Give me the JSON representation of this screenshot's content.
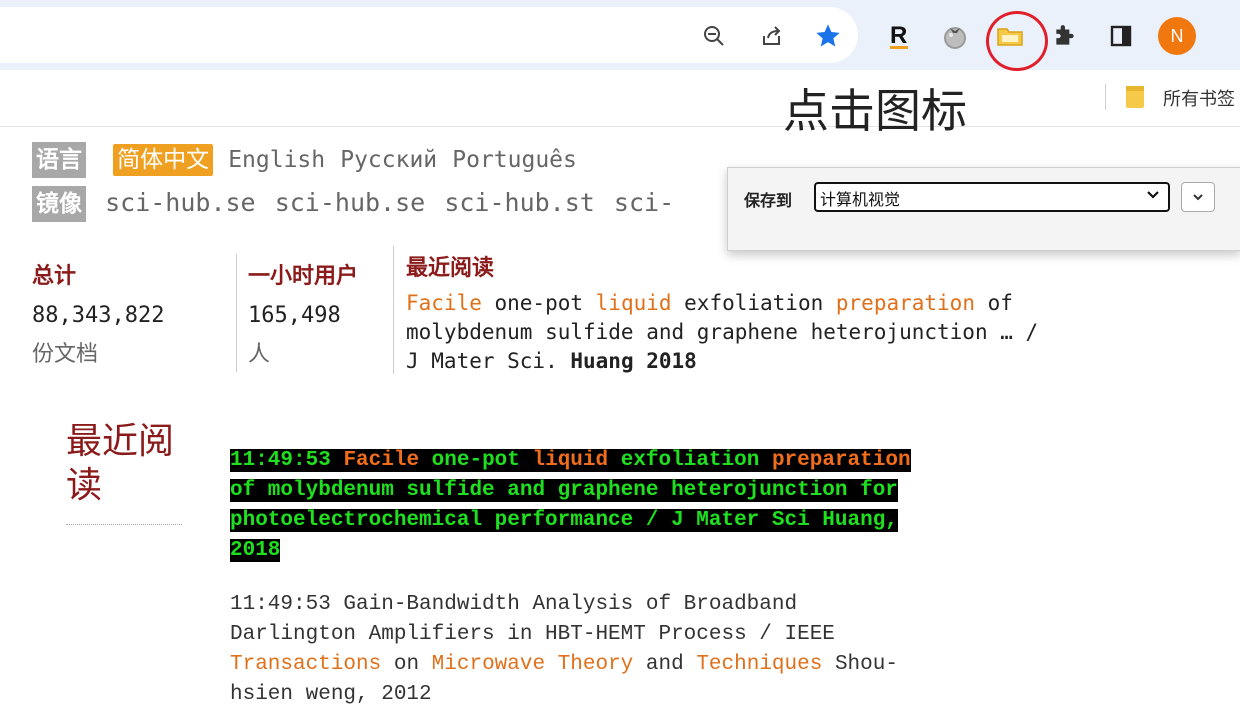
{
  "chrome": {
    "profile_initial": "N",
    "bookmarks_label": "所有书签",
    "icons": [
      "zoom-icon",
      "share-icon",
      "star-icon",
      "r-extension-icon",
      "tomato-extension-icon",
      "folder-extension-icon",
      "puzzle-extensions-icon",
      "side-panel-icon",
      "profile-avatar"
    ],
    "accent_star": "#1a73e8",
    "profile_color": "#f0780f"
  },
  "annotation": {
    "text": "点击图标",
    "ring_color": "#e01f2b"
  },
  "page": {
    "lang_chip": "语言",
    "lang_active": "简体中文",
    "langs": [
      "English",
      "Русский",
      "Português"
    ],
    "mirror_chip": "镜像",
    "mirrors": [
      "sci-hub.se",
      "sci-hub.se",
      "sci-hub.st",
      "sci-"
    ],
    "total_head": "总计",
    "total_value": "88,343,822",
    "total_unit": "份文档",
    "users_head": "一小时用户",
    "users_value": "165,498",
    "users_unit": "人",
    "recent_head": "最近阅读",
    "recent_summary": {
      "w1": "Facile",
      "w2": " one-pot ",
      "w3": "liquid",
      "w4": " exfoliation ",
      "w5": "preparation",
      "w6": " of",
      "line2": "molybdenum sulfide and graphene heterojunction … /",
      "line3a": "J Mater Sci. ",
      "line3b": "Huang 2018"
    },
    "recent_label": "最近阅读",
    "entry1": {
      "time": "11:49:53",
      "w1": "Facile",
      "w2": " one-pot ",
      "w3": "liquid",
      "w4": " exfoliation ",
      "w5": "preparation",
      "line2": "of molybdenum sulfide and graphene heterojunction for",
      "line3": "photoelectrochemical performance / J Mater Sci Huang,",
      "line4": "2018"
    },
    "entry2": {
      "line1": "11:49:53 Gain-Bandwidth Analysis of Broadband",
      "line2": "Darlington Amplifiers in HBT-HEMT Process / IEEE",
      "w1": "Transactions",
      "w2": " on ",
      "w3": "Microwave Theory",
      "w4": " and ",
      "w5": "Techniques",
      "w6": " Shou-",
      "line4": "hsien weng, 2012"
    }
  },
  "popup": {
    "save_to_label": "保存到",
    "selected_folder": "计算机视觉"
  }
}
